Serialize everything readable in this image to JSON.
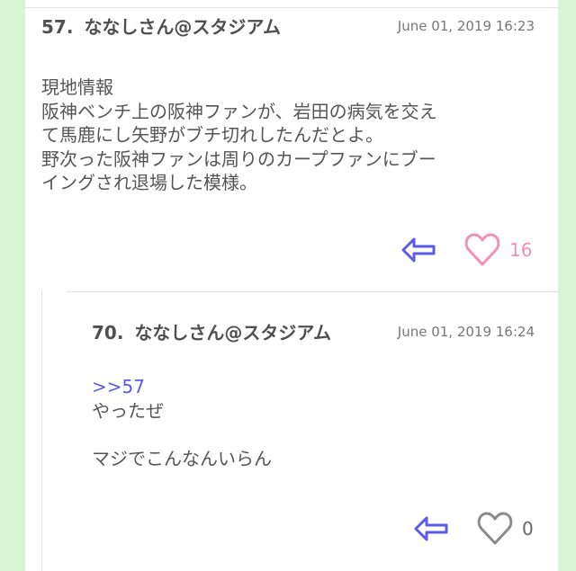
{
  "post57": {
    "number": "57.",
    "name": "ななしさん@スタジアム",
    "date": "June 01, 2019 16:23",
    "lines": [
      "現地情報",
      "阪神ベンチ上の阪神ファンが、岩田の病気を交え",
      "て馬鹿にし矢野がブチ切れしたんだとよ。",
      "野次った阪神ファンは周りのカープファンにブー",
      "イングされ退場した模様。"
    ],
    "like_count": "16",
    "icons": {
      "reply": "reply-arrow-icon",
      "like": "heart-icon"
    },
    "colors": {
      "reply": "#5b5be8",
      "like": "#f28fb5"
    }
  },
  "post70": {
    "number": "70.",
    "name": "ななしさん@スタジアム",
    "date": "June 01, 2019 16:24",
    "anchor": ">>57",
    "lines": [
      "やったぜ",
      "",
      "マジでこんなんいらん"
    ],
    "like_count": "0",
    "icons": {
      "reply": "reply-arrow-icon",
      "like": "heart-icon"
    },
    "colors": {
      "reply": "#5b5be8",
      "like": "#8a8a8a"
    }
  },
  "theme": {
    "side_bg": "#d7f5d3",
    "text": "#555555",
    "header": "#4f4f4f"
  }
}
